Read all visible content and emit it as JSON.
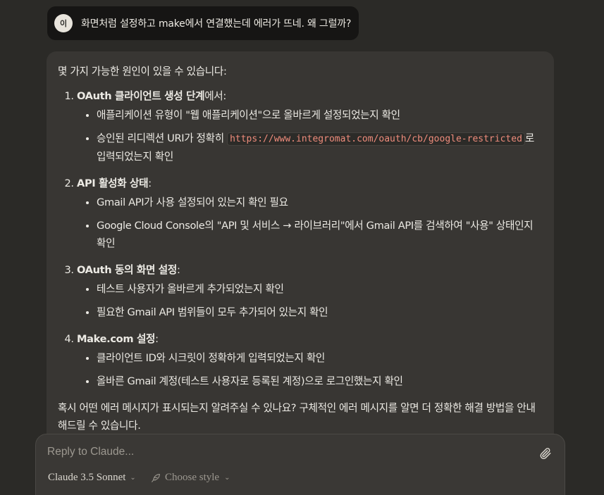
{
  "user_message": {
    "avatar_initial": "이",
    "text": "화면처럼 설정하고 make에서 연결했는데 에러가 뜨네. 왜 그럴까?"
  },
  "assistant_message": {
    "intro": "몇 가지 가능한 원인이 있을 수 있습니다:",
    "steps": [
      {
        "title": "OAuth 클라이언트 생성 단계",
        "title_suffix": "에서:",
        "bullets": [
          {
            "text": "애플리케이션 유형이 \"웹 애플리케이션\"으로 올바르게 설정되었는지 확인"
          },
          {
            "prefix": "승인된 리디렉션 URI가 정확히 ",
            "code": "https://www.integromat.com/oauth/cb/google-restricted",
            "suffix": "로 입력되었는지 확인"
          }
        ]
      },
      {
        "title": "API 활성화 상태",
        "title_suffix": ":",
        "bullets": [
          {
            "text": "Gmail API가 사용 설정되어 있는지 확인 필요"
          },
          {
            "text": "Google Cloud Console의 \"API 및 서비스 → 라이브러리\"에서 Gmail API를 검색하여 \"사용\" 상태인지 확인"
          }
        ]
      },
      {
        "title": "OAuth 동의 화면 설정",
        "title_suffix": ":",
        "bullets": [
          {
            "text": "테스트 사용자가 올바르게 추가되었는지 확인"
          },
          {
            "text": "필요한 Gmail API 범위들이 모두 추가되어 있는지 확인"
          }
        ]
      },
      {
        "title": "Make.com 설정",
        "title_suffix": ":",
        "bullets": [
          {
            "text": "클라이언트 ID와 시크릿이 정확하게 입력되었는지 확인"
          },
          {
            "text": "올바른 Gmail 계정(테스트 사용자로 등록된 계정)으로 로그인했는지 확인"
          }
        ]
      }
    ],
    "outro": "혹시 어떤 에러 메시지가 표시되는지 알려주실 수 있나요? 구체적인 에러 메시지를 알면 더 정확한 해결 방법을 안내해드릴 수 있습니다."
  },
  "composer": {
    "placeholder": "Reply to Claude...",
    "model_label": "Claude 3.5 Sonnet",
    "style_label": "Choose style",
    "attach_icon": "paperclip-icon",
    "style_icon": "feather-icon"
  },
  "colors": {
    "background": "#2b2a27",
    "user_bubble": "#161514",
    "assistant_bubble": "#383633",
    "code_text": "#ef8c7c"
  }
}
